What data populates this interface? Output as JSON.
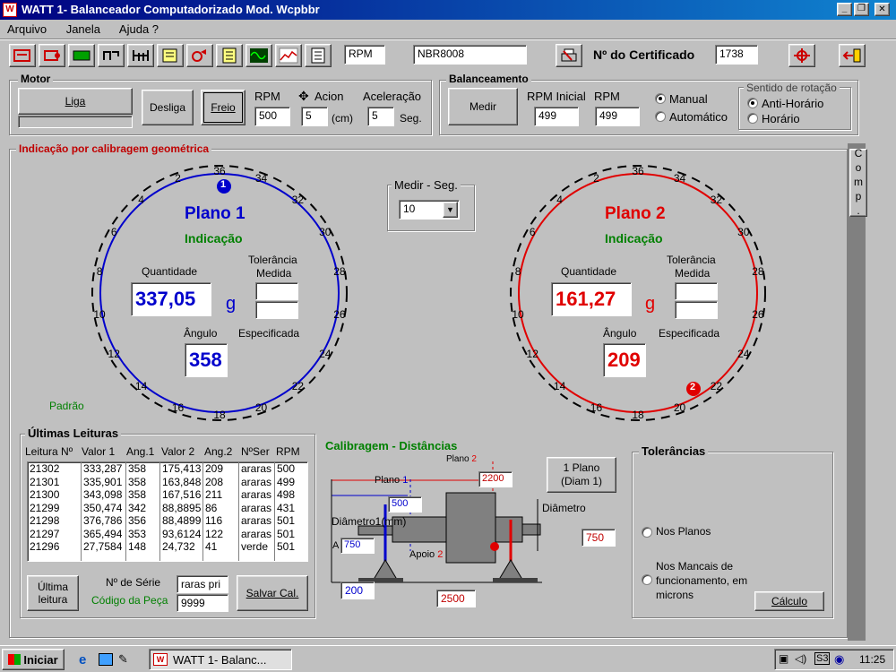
{
  "window": {
    "title": "WATT 1- Balanceador Computadorizado  Mod. Wcpbbr"
  },
  "menu": [
    "Arquivo",
    "Janela",
    "Ajuda ?"
  ],
  "toolbar": {
    "rpm_field": "RPM",
    "norm_field": "NBR8008",
    "cert_label": "Nº do Certificado",
    "cert_value": "1738"
  },
  "motor": {
    "legend": "Motor",
    "liga": "Liga",
    "desliga": "Desliga",
    "freio": "Freio",
    "rpm_label": "RPM",
    "rpm_value": "500",
    "acion_label": "Acion",
    "acion_value": "5",
    "acion_unit": "(cm)",
    "acel_label": "Aceleração",
    "acel_value": "5",
    "acel_unit": "Seg."
  },
  "balanceamento": {
    "legend": "Balanceamento",
    "medir": "Medir",
    "rpm_inicial_label": "RPM Inicial",
    "rpm_inicial_value": "499",
    "rpm_label": "RPM",
    "rpm_value": "499",
    "manual": "Manual",
    "automatico": "Automático",
    "sentido_legend": "Sentido de rotação",
    "anti_horario": "Anti-Horário",
    "horario": "Horário"
  },
  "indicacao": {
    "legend": "Indicação por calibragem geométrica",
    "comp": "Comp.",
    "medir_seg_label": "Medir - Seg.",
    "medir_seg_value": "10",
    "padrao": "Padrão",
    "dial_numbers": [
      "36",
      "34",
      "32",
      "30",
      "28",
      "26",
      "24",
      "22",
      "20",
      "18",
      "16",
      "14",
      "12",
      "10",
      "8",
      "6",
      "4",
      "2"
    ],
    "plano1": {
      "title": "Plano 1",
      "subtitle": "Indicação",
      "quantidade_label": "Quantidade",
      "quantidade": "337,05",
      "unit": "g",
      "angulo_label": "Ângulo",
      "angulo": "358",
      "tolerancia_label": "Tolerância",
      "medida_label": "Medida",
      "especificada_label": "Especificada",
      "marker": "1"
    },
    "plano2": {
      "title": "Plano 2",
      "subtitle": "Indicação",
      "quantidade_label": "Quantidade",
      "quantidade": "161,27",
      "unit": "g",
      "angulo_label": "Ângulo",
      "angulo": "209",
      "tolerancia_label": "Tolerância",
      "medida_label": "Medida",
      "especificada_label": "Especificada",
      "marker": "2"
    }
  },
  "ultimas": {
    "legend": "Últimas Leituras",
    "headers": [
      "Leitura Nº",
      "Valor 1",
      "Ang.1",
      "Valor 2",
      "Ang.2",
      "NºSer",
      "RPM"
    ],
    "rows": [
      [
        "21302",
        "333,287",
        "358",
        "175,413",
        "209",
        "araras",
        "500"
      ],
      [
        "21301",
        "335,901",
        "358",
        "163,848",
        "208",
        "araras",
        "499"
      ],
      [
        "21300",
        "343,098",
        "358",
        "167,516",
        "211",
        "araras",
        "498"
      ],
      [
        "21299",
        "350,474",
        "342",
        "88,8895",
        "86",
        "araras",
        "431"
      ],
      [
        "21298",
        "376,786",
        "356",
        "88,4899",
        "116",
        "araras",
        "501"
      ],
      [
        "21297",
        "365,494",
        "353",
        "93,6124",
        "122",
        "araras",
        "501"
      ],
      [
        "21296",
        "27,7584",
        "148",
        "24,732",
        "41",
        "verde",
        "501"
      ]
    ],
    "ultima_leitura": "Última leitura",
    "serie_label": "Nº de Série",
    "serie_value": "raras pri",
    "codigo_label": "Código da Peça",
    "codigo_value": "9999",
    "salvar": "Salvar Cal."
  },
  "calibragem": {
    "title": "Calibragem - Distâncias",
    "plano2_label": "Plano",
    "plano2_num": "2",
    "plano1_label": "Plano",
    "plano1_num": "1",
    "diametro1_label": "Diâmetro1(mm)",
    "diametro_label": "Diâmetro",
    "apoio_label": "Apoio",
    "apoio_num": "2",
    "a_label": "A",
    "v2200": "2200",
    "v500": "500",
    "v750a": "750",
    "v750b": "750",
    "v200": "200",
    "v2500": "2500",
    "plano_btn": "1 Plano (Diam 1)"
  },
  "tolerancias": {
    "legend": "Tolerâncias",
    "nos_planos": "Nos Planos",
    "nos_mancais": "Nos Mancais de funcionamento, em microns",
    "calculo": "Cálculo"
  },
  "taskbar": {
    "start": "Iniciar",
    "task": "WATT 1- Balanc...",
    "clock": "11:25"
  },
  "colors": {
    "plano1": "#0000cc",
    "plano2": "#e00000",
    "green": "#008000",
    "title": "#000080"
  }
}
